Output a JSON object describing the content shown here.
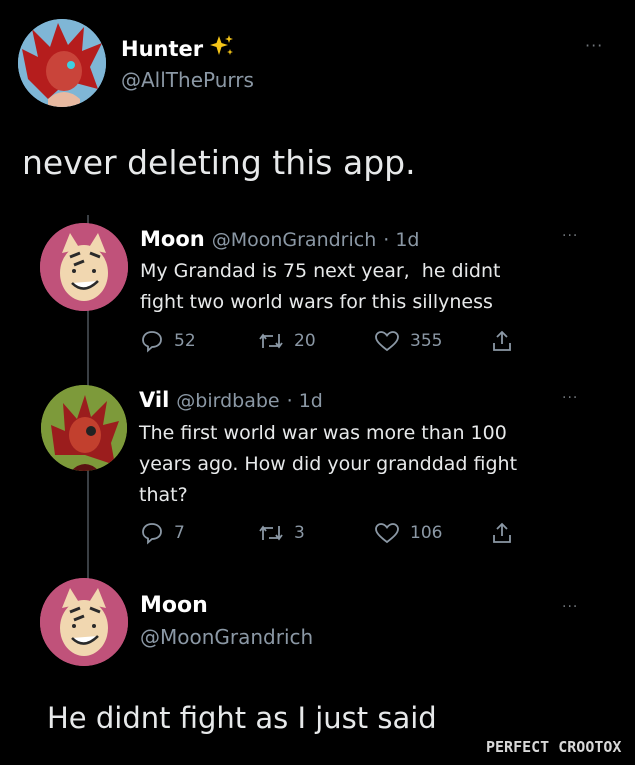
{
  "header": {
    "display_name": "Hunter",
    "sparkle_icon": "sparkles-icon",
    "handle": "@AllThePurrs",
    "more": "···"
  },
  "main_tweet": {
    "text": "never deleting this app."
  },
  "reply1": {
    "name": "Moon",
    "handle": "@MoonGrandrich",
    "time": "· 1d",
    "line1": "My Grandad is 75 next year,  he didnt",
    "line2": "fight two world wars for this sillyness",
    "replies": "52",
    "retweets": "20",
    "likes": "355",
    "more": "···"
  },
  "reply2": {
    "name": "Vil",
    "handle": "@birdbabe",
    "time": "· 1d",
    "line1": "The first world war was more than 100",
    "line2": "years ago. How did your granddad fight",
    "line3": "that?",
    "replies": "7",
    "retweets": "3",
    "likes": "106",
    "more": "···"
  },
  "reply3": {
    "name": "Moon",
    "handle": "@MoonGrandrich",
    "text": "He didnt fight as I just said",
    "more": "···"
  },
  "watermark": "PERFECT CROOTOX",
  "colors": {
    "background": "#000000",
    "text": "#e7e9ea",
    "muted": "#8b98a5",
    "sparkle": "#f5c518"
  }
}
